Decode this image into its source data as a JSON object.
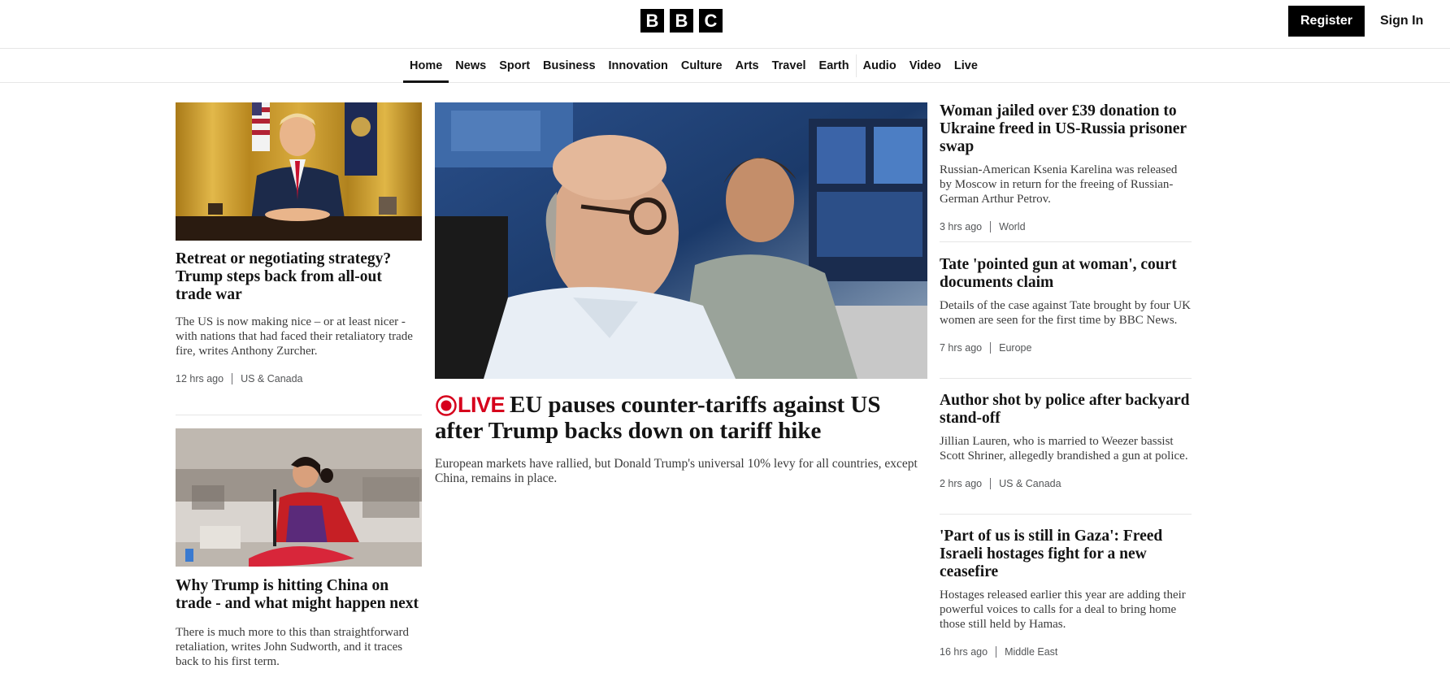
{
  "header": {
    "logo_letters": [
      "B",
      "B",
      "C"
    ],
    "register_label": "Register",
    "signin_label": "Sign In"
  },
  "nav": {
    "items": [
      {
        "label": "Home",
        "active": true
      },
      {
        "label": "News"
      },
      {
        "label": "Sport"
      },
      {
        "label": "Business"
      },
      {
        "label": "Innovation"
      },
      {
        "label": "Culture"
      },
      {
        "label": "Arts"
      },
      {
        "label": "Travel"
      },
      {
        "label": "Earth"
      },
      {
        "label": "Audio"
      },
      {
        "label": "Video"
      },
      {
        "label": "Live"
      }
    ]
  },
  "left": {
    "story1": {
      "headline": "Retreat or negotiating strategy? Trump steps back from all-out trade war",
      "summary": "The US is now making nice – or at least nicer - with nations that had faced their retaliatory trade fire, writes Anthony Zurcher.",
      "time": "12 hrs ago",
      "section": "US & Canada"
    },
    "story2": {
      "headline": "Why Trump is hitting China on trade - and what might happen next",
      "summary": "There is much more to this than straightforward retaliation, writes John Sudworth, and it traces back to his first term."
    }
  },
  "center": {
    "live_label": "LIVE",
    "headline": "EU pauses counter-tariffs against US after Trump backs down on tariff hike",
    "summary": "European markets have rallied, but Donald Trump's universal 10% levy for all countries, except China, remains in place."
  },
  "right": {
    "stories": [
      {
        "headline": "Woman jailed over £39 donation to Ukraine freed in US-Russia prisoner swap",
        "summary": "Russian-American Ksenia Karelina was released by Moscow in return for the freeing of Russian-German Arthur Petrov.",
        "time": "3 hrs ago",
        "section": "World"
      },
      {
        "headline": "Tate 'pointed gun at woman', court documents claim",
        "summary": "Details of the case against Tate brought by four UK women are seen for the first time by BBC News.",
        "time": "7 hrs ago",
        "section": "Europe"
      },
      {
        "headline": "Author shot by police after backyard stand-off",
        "summary": "Jillian Lauren, who is married to Weezer bassist Scott Shriner, allegedly brandished a gun at police.",
        "time": "2 hrs ago",
        "section": "US & Canada"
      },
      {
        "headline": "'Part of us is still in Gaza': Freed Israeli hostages fight for a new ceasefire",
        "summary": "Hostages released earlier this year are adding their powerful voices to calls for a deal to bring home those still held by Hamas.",
        "time": "16 hrs ago",
        "section": "Middle East"
      }
    ]
  },
  "colors": {
    "live_red": "#d6001c",
    "text": "#141414",
    "muted": "#545658",
    "divider": "#e6e6e6"
  }
}
